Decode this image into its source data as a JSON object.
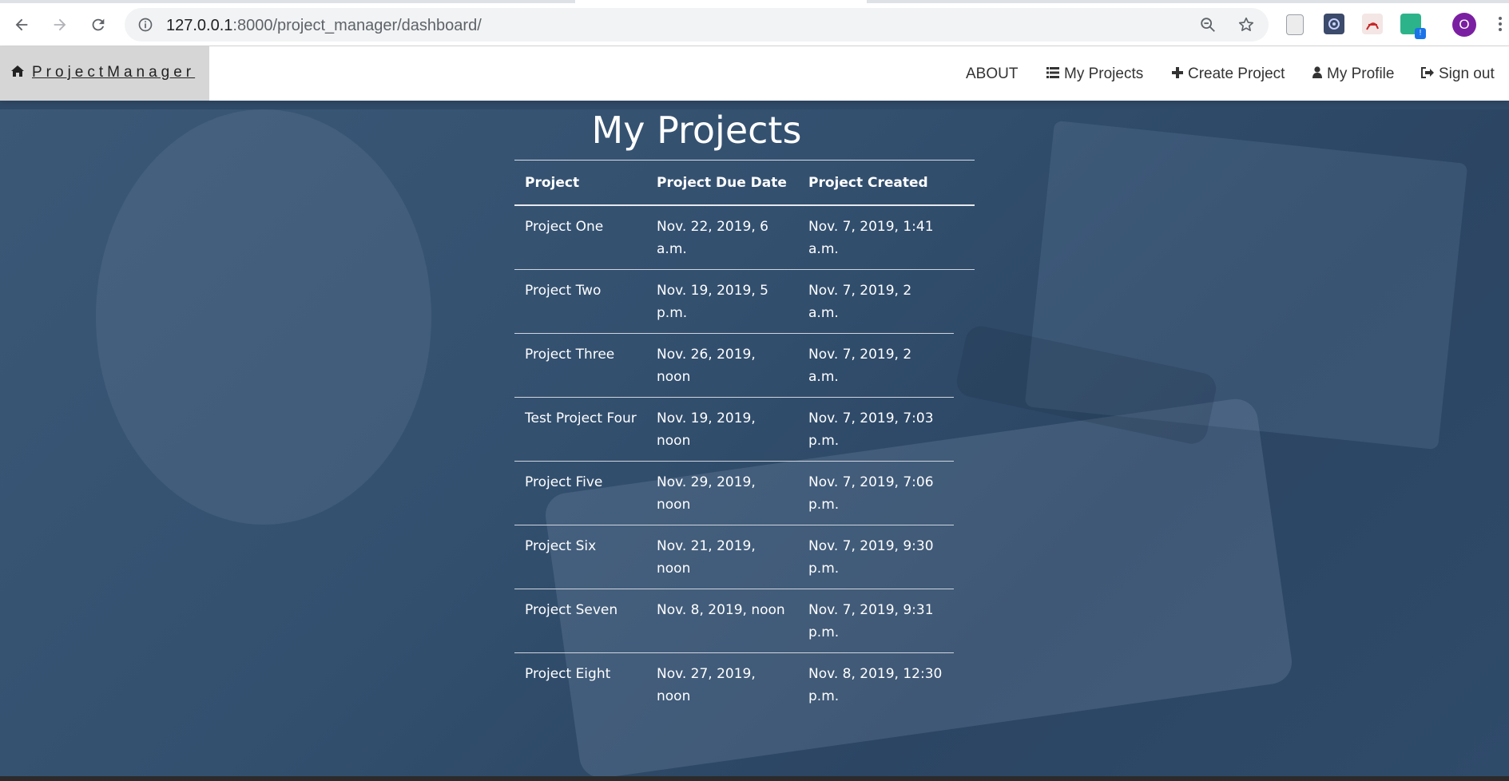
{
  "browser": {
    "url_host": "127.0.0.1",
    "url_path": ":8000/project_manager/dashboard/",
    "profile_initial": "O",
    "icons": [
      "back-icon",
      "forward-icon",
      "reload-icon",
      "info-icon",
      "zoom-out-icon",
      "star-icon",
      "document-icon",
      "puzzle-icon",
      "acrobat-icon",
      "extension-badge-icon"
    ]
  },
  "navbar": {
    "brand": "ProjectManager",
    "links": {
      "about": "ABOUT",
      "my_projects": "My Projects",
      "create_project": "Create Project",
      "my_profile": "My Profile",
      "sign_out": "Sign out"
    }
  },
  "main": {
    "title": "My Projects",
    "columns": [
      "Project",
      "Project Due Date",
      "Project Created"
    ],
    "rows": [
      {
        "project": "Project One",
        "due": "Nov. 22, 2019, 6 a.m.",
        "created": "Nov. 7, 2019, 1:41 a.m."
      },
      {
        "project": "Project Two",
        "due": "Nov. 19, 2019, 5 p.m.",
        "created": "Nov. 7, 2019, 2 a.m."
      },
      {
        "project": "Project Three",
        "due": "Nov. 26, 2019, noon",
        "created": "Nov. 7, 2019, 2 a.m."
      },
      {
        "project": "Test Project Four",
        "due": "Nov. 19, 2019, noon",
        "created": "Nov. 7, 2019, 7:03 p.m."
      },
      {
        "project": "Project Five",
        "due": "Nov. 29, 2019, noon",
        "created": "Nov. 7, 2019, 7:06 p.m."
      },
      {
        "project": "Project Six",
        "due": "Nov. 21, 2019, noon",
        "created": "Nov. 7, 2019, 9:30 p.m."
      },
      {
        "project": "Project Seven",
        "due": "Nov. 8, 2019, noon",
        "created": "Nov. 7, 2019, 9:31 p.m."
      },
      {
        "project": "Project Eight",
        "due": "Nov. 27, 2019, noon",
        "created": "Nov. 8, 2019, 12:30 p.m."
      }
    ]
  },
  "colors": {
    "background": "#2f4a68",
    "navbar": "#ffffff",
    "brand_box": "#d6d6d6",
    "avatar": "#7b1fa2"
  }
}
